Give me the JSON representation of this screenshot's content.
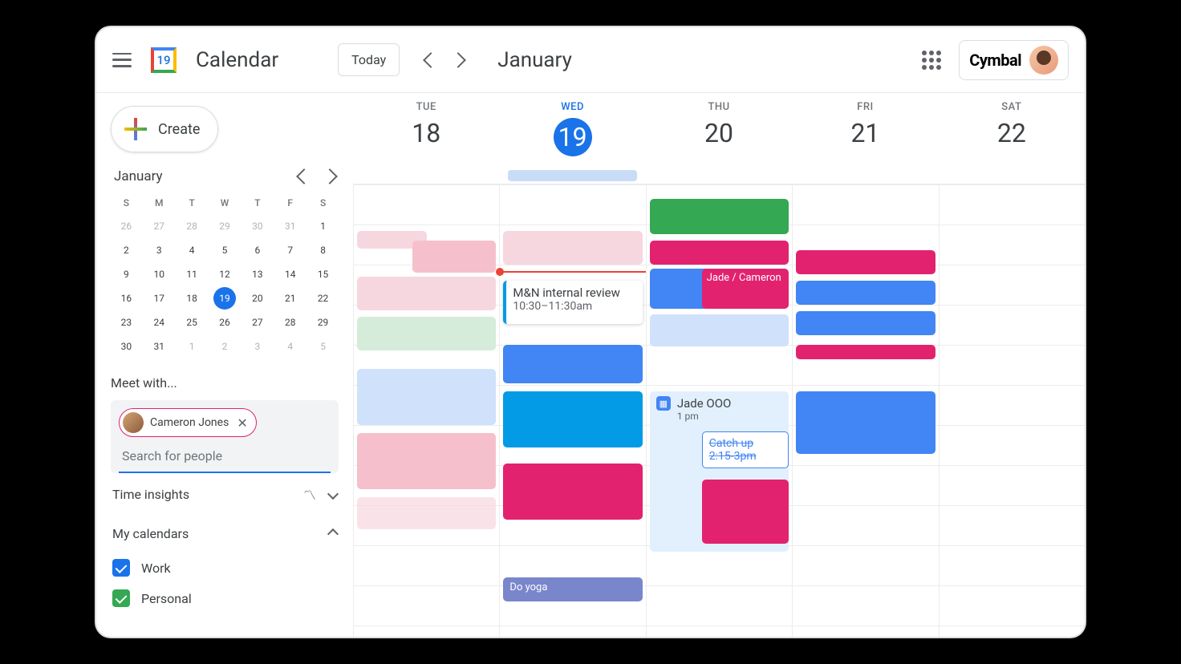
{
  "header": {
    "app_title": "Calendar",
    "logo_day": "19",
    "today_label": "Today",
    "month_title": "January",
    "org_name": "Cymbal"
  },
  "create": {
    "label": "Create"
  },
  "mini": {
    "month": "January",
    "dow": [
      "S",
      "M",
      "T",
      "W",
      "T",
      "F",
      "S"
    ],
    "weeks": [
      [
        {
          "n": "26",
          "dim": true
        },
        {
          "n": "27",
          "dim": true
        },
        {
          "n": "28",
          "dim": true
        },
        {
          "n": "29",
          "dim": true
        },
        {
          "n": "30",
          "dim": true
        },
        {
          "n": "31",
          "dim": true
        },
        {
          "n": "1"
        }
      ],
      [
        {
          "n": "2"
        },
        {
          "n": "3"
        },
        {
          "n": "4"
        },
        {
          "n": "5"
        },
        {
          "n": "6"
        },
        {
          "n": "7"
        },
        {
          "n": "8"
        }
      ],
      [
        {
          "n": "9"
        },
        {
          "n": "10"
        },
        {
          "n": "11"
        },
        {
          "n": "12"
        },
        {
          "n": "13"
        },
        {
          "n": "14"
        },
        {
          "n": "15"
        }
      ],
      [
        {
          "n": "16"
        },
        {
          "n": "17"
        },
        {
          "n": "18"
        },
        {
          "n": "19",
          "today": true
        },
        {
          "n": "20"
        },
        {
          "n": "21"
        },
        {
          "n": "22"
        }
      ],
      [
        {
          "n": "23"
        },
        {
          "n": "24"
        },
        {
          "n": "25"
        },
        {
          "n": "26"
        },
        {
          "n": "27"
        },
        {
          "n": "28"
        },
        {
          "n": "29"
        }
      ],
      [
        {
          "n": "30"
        },
        {
          "n": "31"
        },
        {
          "n": "1",
          "dim": true
        },
        {
          "n": "2",
          "dim": true
        },
        {
          "n": "3",
          "dim": true
        },
        {
          "n": "4",
          "dim": true
        },
        {
          "n": "5",
          "dim": true
        }
      ]
    ]
  },
  "meet": {
    "label": "Meet with...",
    "chip_name": "Cameron Jones",
    "search_placeholder": "Search for people"
  },
  "insights": {
    "label": "Time insights"
  },
  "mycals": {
    "label": "My calendars",
    "items": [
      {
        "name": "Work",
        "color": "blue"
      },
      {
        "name": "Personal",
        "color": "green"
      }
    ]
  },
  "days": [
    {
      "dow": "TUE",
      "num": "18"
    },
    {
      "dow": "WED",
      "num": "19",
      "active": true
    },
    {
      "dow": "THU",
      "num": "20"
    },
    {
      "dow": "FRI",
      "num": "21"
    },
    {
      "dow": "SAT",
      "num": "22"
    }
  ],
  "events": {
    "wed_meeting_title": "M&N internal review",
    "wed_meeting_time": "10:30–11:30am",
    "thu_jade_title": "Jade / Cameron",
    "thu_ooo_title": "Jade OOO",
    "thu_ooo_time": "1 pm",
    "thu_catch_title": "Catch up",
    "thu_catch_time": "2:15-3pm",
    "wed_yoga": "Do yoga"
  }
}
